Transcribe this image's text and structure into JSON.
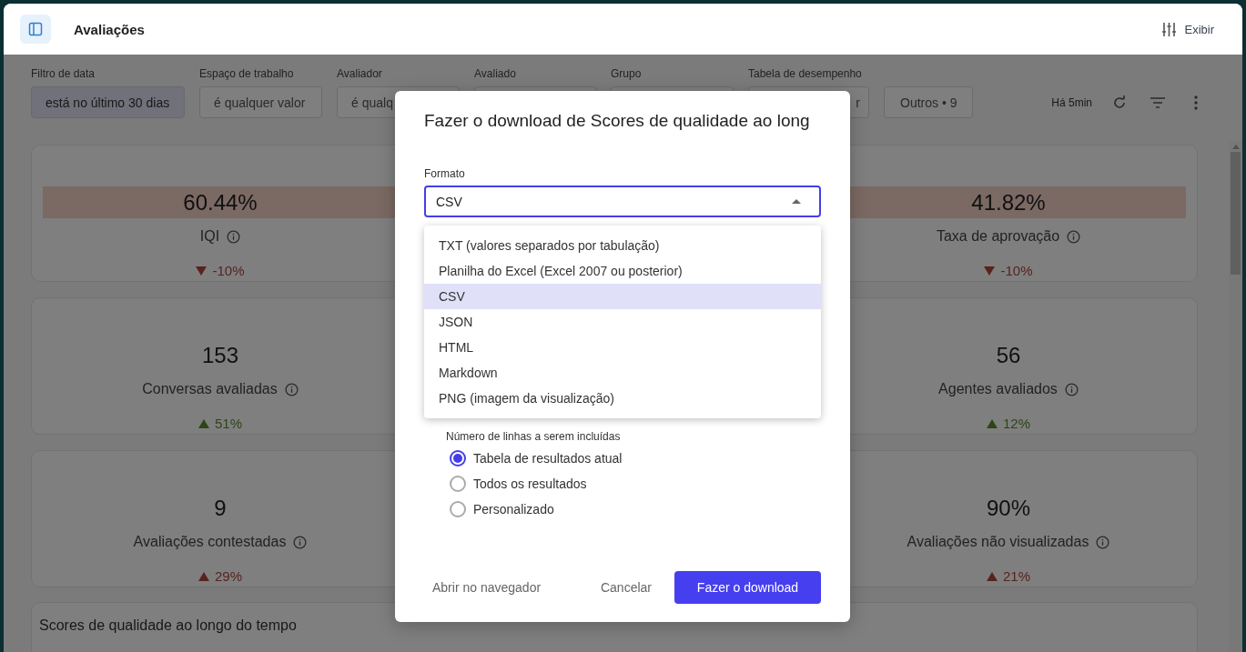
{
  "header": {
    "title": "Avaliações",
    "view_button": "Exibir"
  },
  "filters": [
    {
      "label": "Filtro de data",
      "value": "está no último 30 dias",
      "active": true
    },
    {
      "label": "Espaço de trabalho",
      "value": "é qualquer valor",
      "active": false
    },
    {
      "label": "Avaliador",
      "value": "é qualq",
      "active": false
    },
    {
      "label": "Avaliado",
      "active": false
    },
    {
      "label": "Grupo",
      "active": false
    },
    {
      "label": "Tabela de desempenho",
      "value": "r",
      "active": false
    }
  ],
  "more_filters": "Outros • 9",
  "updated": "Há 5min",
  "metric_rows": [
    {
      "left": {
        "value": "60.44%",
        "label": "IQI",
        "change": "-10%",
        "kind": "drop",
        "highlighted": true
      },
      "right": {
        "value": "41.82%",
        "label": "Taxa de aprovação",
        "change": "-10%",
        "kind": "drop",
        "highlighted": true
      }
    },
    {
      "left": {
        "value": "153",
        "label": "Conversas avaliadas",
        "change": "51%",
        "kind": "gain",
        "highlighted": false
      },
      "right": {
        "value": "56",
        "label": "Agentes avaliados",
        "change": "12%",
        "kind": "gain",
        "highlighted": false
      }
    },
    {
      "left": {
        "value": "9",
        "label": "Avaliações contestadas",
        "change": "29%",
        "kind": "spike",
        "highlighted": false
      },
      "right": {
        "value": "90%",
        "label": "Avaliações não visualizadas",
        "change": "21%",
        "kind": "spike",
        "highlighted": false
      }
    }
  ],
  "chart": {
    "title": "Scores de qualidade ao longo do tempo"
  },
  "dialog": {
    "title": "Fazer o download de Scores de qualidade ao long",
    "format_label": "Formato",
    "format_value": "CSV",
    "expanded": true,
    "options": [
      {
        "label": "TXT (valores separados por tabulação)",
        "selected": false
      },
      {
        "label": "Planilha do Excel (Excel 2007 ou posterior)",
        "selected": false
      },
      {
        "label": "CSV",
        "selected": true
      },
      {
        "label": "JSON",
        "selected": false
      },
      {
        "label": "HTML",
        "selected": false
      },
      {
        "label": "Markdown",
        "selected": false
      },
      {
        "label": "PNG (imagem da visualização)",
        "selected": false
      }
    ],
    "rows_label": "Número de linhas a serem incluídas",
    "row_options": [
      {
        "label": "Tabela de resultados atual",
        "checked": true
      },
      {
        "label": "Todos os resultados",
        "checked": false
      },
      {
        "label": "Personalizado",
        "checked": false
      }
    ],
    "open_button": "Abrir no navegador",
    "cancel_button": "Cancelar",
    "download_button": "Fazer o download"
  }
}
